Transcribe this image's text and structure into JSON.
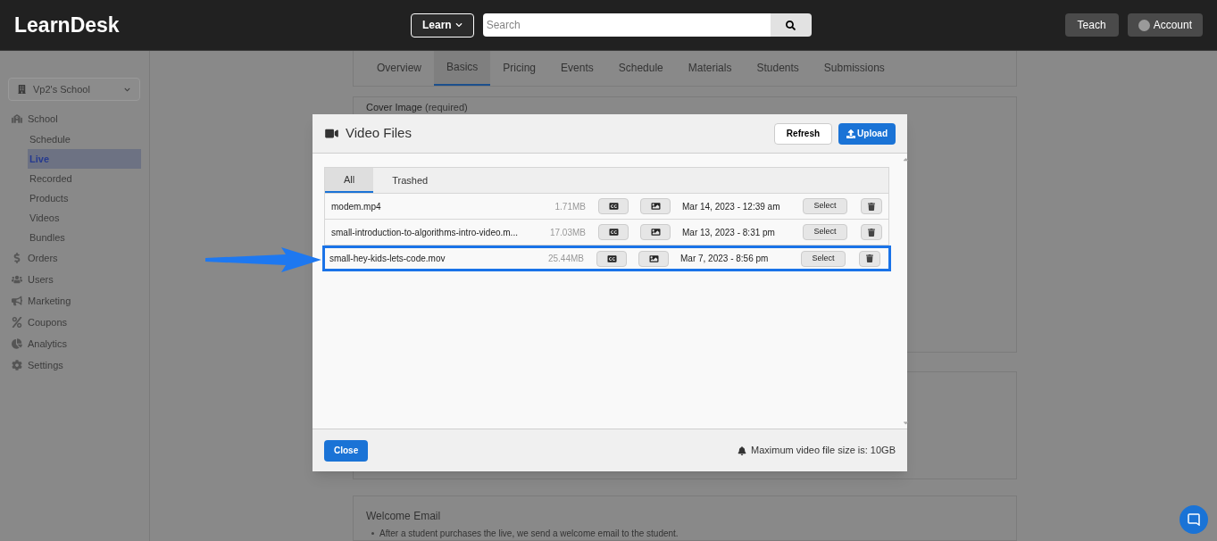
{
  "header": {
    "logo": "LearnDesk",
    "learn_menu": "Learn",
    "search": {
      "placeholder": "Search"
    },
    "teach": "Teach",
    "account": "Account"
  },
  "sidebar": {
    "school_picker": "Vp2's School",
    "items": [
      {
        "label": "School",
        "children": [
          {
            "label": "Schedule",
            "selected": false
          },
          {
            "label": "Live",
            "selected": true
          },
          {
            "label": "Recorded",
            "selected": false
          },
          {
            "label": "Products",
            "selected": false
          },
          {
            "label": "Videos",
            "selected": false
          },
          {
            "label": "Bundles",
            "selected": false
          }
        ]
      },
      {
        "label": "Orders"
      },
      {
        "label": "Users"
      },
      {
        "label": "Marketing"
      },
      {
        "label": "Coupons"
      },
      {
        "label": "Analytics"
      },
      {
        "label": "Settings"
      }
    ]
  },
  "course_tabs": [
    {
      "label": "Overview",
      "selected": false
    },
    {
      "label": "Basics",
      "selected": true
    },
    {
      "label": "Pricing",
      "selected": false
    },
    {
      "label": "Events",
      "selected": false
    },
    {
      "label": "Schedule",
      "selected": false
    },
    {
      "label": "Materials",
      "selected": false
    },
    {
      "label": "Students",
      "selected": false
    },
    {
      "label": "Submissions",
      "selected": false
    }
  ],
  "cover_image": {
    "title": "Cover Image",
    "note": "(required)"
  },
  "welcome_email": {
    "title": "Welcome Email",
    "bullet": "After a student purchases the live, we send a welcome email to the student."
  },
  "dialog": {
    "title": "Video Files",
    "refresh": "Refresh",
    "upload": "Upload",
    "tabs": [
      {
        "label": "All",
        "selected": true
      },
      {
        "label": "Trashed",
        "selected": false
      }
    ],
    "files": [
      {
        "name": "modem.mp4",
        "size": "1.71MB",
        "date": "Mar 14, 2023 - 12:39 am",
        "select": "Select",
        "highlighted": false
      },
      {
        "name": "small-introduction-to-algorithms-intro-video.m...",
        "size": "17.03MB",
        "date": "Mar 13, 2023 - 8:31 pm",
        "select": "Select",
        "highlighted": false
      },
      {
        "name": "small-hey-kids-lets-code.mov",
        "size": "25.44MB",
        "date": "Mar 7, 2023 - 8:56 pm",
        "select": "Select",
        "highlighted": true
      }
    ],
    "close": "Close",
    "footer_note": "Maximum video file size is: 10GB"
  }
}
